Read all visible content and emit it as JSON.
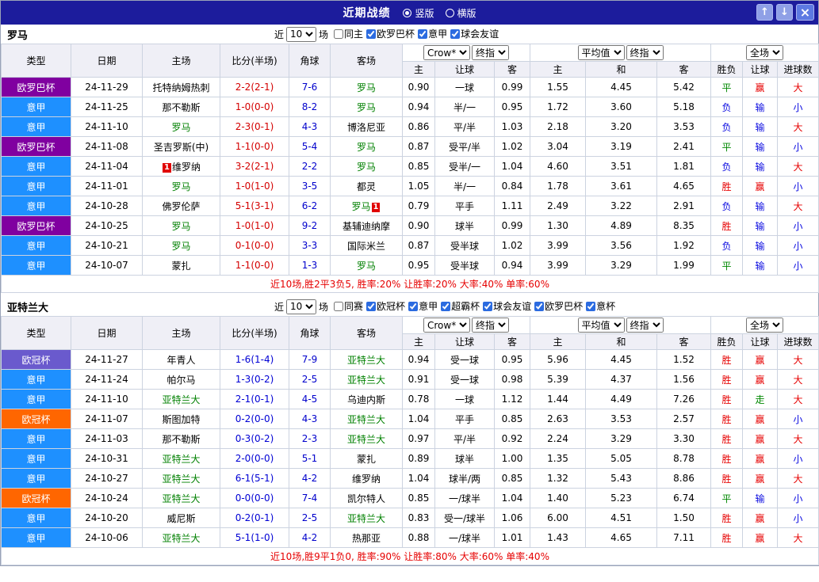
{
  "colors": {
    "css": {
      "titlebar-bg": "#1c1c9c",
      "grid-border": "#ccd3e0",
      "header-bg": "#efeff6",
      "summary-red": "#e60000",
      "badge-red": "#e00000",
      "btn-updown-bg": "#8fa0e6",
      "btn-close-bg": "#5d7ae2"
    },
    "team_self": "#008000",
    "result_map": {
      "胜": "#e60000",
      "赢": "#e60000",
      "大": "#e60000",
      "负": "#0b0be0",
      "输": "#0b0be0",
      "小": "#0b0be0",
      "平": "#008800",
      "走": "#008800"
    }
  },
  "titlebar": {
    "title": "近期战绩",
    "radios": [
      {
        "label": "竖版",
        "selected": true
      },
      {
        "label": "横版",
        "selected": false
      }
    ],
    "buttons": [
      {
        "name": "scroll-up",
        "glyph": "↑"
      },
      {
        "name": "scroll-down",
        "glyph": "↓"
      },
      {
        "name": "close",
        "glyph": "×"
      }
    ]
  },
  "columns": {
    "main": [
      "类型",
      "日期",
      "主场",
      "比分(半场)",
      "角球",
      "客场"
    ],
    "sub": [
      "主",
      "让球",
      "客",
      "主",
      "和",
      "客",
      "胜负",
      "让球",
      "进球数"
    ],
    "selects": [
      [
        "Crow*",
        "终指"
      ],
      [
        "平均值",
        "终指"
      ],
      [
        "全场"
      ]
    ]
  },
  "sections": [
    {
      "team": "罗马",
      "filter": {
        "prefix": "近",
        "count": "10",
        "suffix": "场",
        "checks": [
          {
            "label": "同主",
            "checked": false
          },
          {
            "label": "欧罗巴杯",
            "checked": true
          },
          {
            "label": "意甲",
            "checked": true
          },
          {
            "label": "球会友谊",
            "checked": true
          }
        ]
      },
      "score_color": "#d40000",
      "corner_color": "#0000cc",
      "rows": [
        {
          "type": "欧罗巴杯",
          "type_color": "#8000a0",
          "date": "24-11-29",
          "home": {
            "name": "托特纳姆热刺"
          },
          "score": "2-2(2-1)",
          "corner": "7-6",
          "away": {
            "name": "罗马",
            "self": true
          },
          "ah": [
            "0.90",
            "一球",
            "0.99"
          ],
          "eu": [
            "1.55",
            "4.45",
            "5.42"
          ],
          "res": [
            "平",
            "赢",
            "大"
          ]
        },
        {
          "type": "意甲",
          "type_color": "#1e90ff",
          "date": "24-11-25",
          "home": {
            "name": "那不勒斯"
          },
          "score": "1-0(0-0)",
          "corner": "8-2",
          "away": {
            "name": "罗马",
            "self": true
          },
          "ah": [
            "0.94",
            "半/一",
            "0.95"
          ],
          "eu": [
            "1.72",
            "3.60",
            "5.18"
          ],
          "res": [
            "负",
            "输",
            "小"
          ]
        },
        {
          "type": "意甲",
          "type_color": "#1e90ff",
          "date": "24-11-10",
          "home": {
            "name": "罗马",
            "self": true
          },
          "score": "2-3(0-1)",
          "corner": "4-3",
          "away": {
            "name": "博洛尼亚"
          },
          "ah": [
            "0.86",
            "平/半",
            "1.03"
          ],
          "eu": [
            "2.18",
            "3.20",
            "3.53"
          ],
          "res": [
            "负",
            "输",
            "大"
          ]
        },
        {
          "type": "欧罗巴杯",
          "type_color": "#8000a0",
          "date": "24-11-08",
          "home": {
            "name": "圣吉罗斯(中)"
          },
          "score": "1-1(0-0)",
          "corner": "5-4",
          "away": {
            "name": "罗马",
            "self": true
          },
          "ah": [
            "0.87",
            "受平/半",
            "1.02"
          ],
          "eu": [
            "3.04",
            "3.19",
            "2.41"
          ],
          "res": [
            "平",
            "输",
            "小"
          ]
        },
        {
          "type": "意甲",
          "type_color": "#1e90ff",
          "date": "24-11-04",
          "home": {
            "name": "维罗纳",
            "badge": "1",
            "badge_pos": "before"
          },
          "score": "3-2(2-1)",
          "corner": "2-2",
          "away": {
            "name": "罗马",
            "self": true
          },
          "ah": [
            "0.85",
            "受半/一",
            "1.04"
          ],
          "eu": [
            "4.60",
            "3.51",
            "1.81"
          ],
          "res": [
            "负",
            "输",
            "大"
          ]
        },
        {
          "type": "意甲",
          "type_color": "#1e90ff",
          "date": "24-11-01",
          "home": {
            "name": "罗马",
            "self": true
          },
          "score": "1-0(1-0)",
          "corner": "3-5",
          "away": {
            "name": "都灵"
          },
          "ah": [
            "1.05",
            "半/一",
            "0.84"
          ],
          "eu": [
            "1.78",
            "3.61",
            "4.65"
          ],
          "res": [
            "胜",
            "赢",
            "小"
          ]
        },
        {
          "type": "意甲",
          "type_color": "#1e90ff",
          "date": "24-10-28",
          "home": {
            "name": "佛罗伦萨"
          },
          "score": "5-1(3-1)",
          "corner": "6-2",
          "away": {
            "name": "罗马",
            "self": true,
            "badge": "1",
            "badge_pos": "after"
          },
          "ah": [
            "0.79",
            "平手",
            "1.11"
          ],
          "eu": [
            "2.49",
            "3.22",
            "2.91"
          ],
          "res": [
            "负",
            "输",
            "大"
          ]
        },
        {
          "type": "欧罗巴杯",
          "type_color": "#8000a0",
          "date": "24-10-25",
          "home": {
            "name": "罗马",
            "self": true
          },
          "score": "1-0(1-0)",
          "corner": "9-2",
          "away": {
            "name": "基辅迪纳摩"
          },
          "ah": [
            "0.90",
            "球半",
            "0.99"
          ],
          "eu": [
            "1.30",
            "4.89",
            "8.35"
          ],
          "res": [
            "胜",
            "输",
            "小"
          ]
        },
        {
          "type": "意甲",
          "type_color": "#1e90ff",
          "date": "24-10-21",
          "home": {
            "name": "罗马",
            "self": true
          },
          "score": "0-1(0-0)",
          "corner": "3-3",
          "away": {
            "name": "国际米兰"
          },
          "ah": [
            "0.87",
            "受半球",
            "1.02"
          ],
          "eu": [
            "3.99",
            "3.56",
            "1.92"
          ],
          "res": [
            "负",
            "输",
            "小"
          ]
        },
        {
          "type": "意甲",
          "type_color": "#1e90ff",
          "date": "24-10-07",
          "home": {
            "name": "蒙扎"
          },
          "score": "1-1(0-0)",
          "corner": "1-3",
          "away": {
            "name": "罗马",
            "self": true
          },
          "ah": [
            "0.95",
            "受半球",
            "0.94"
          ],
          "eu": [
            "3.99",
            "3.29",
            "1.99"
          ],
          "res": [
            "平",
            "输",
            "小"
          ]
        }
      ],
      "summary": "近10场,胜2平3负5, 胜率:20% 让胜率:20% 大率:40% 单率:60%"
    },
    {
      "team": "亚特兰大",
      "filter": {
        "prefix": "近",
        "count": "10",
        "suffix": "场",
        "checks": [
          {
            "label": "同赛",
            "checked": false
          },
          {
            "label": "欧冠杯",
            "checked": true
          },
          {
            "label": "意甲",
            "checked": true
          },
          {
            "label": "超霸杯",
            "checked": true
          },
          {
            "label": "球会友谊",
            "checked": true
          },
          {
            "label": "欧罗巴杯",
            "checked": true
          },
          {
            "label": "意杯",
            "checked": true
          }
        ]
      },
      "score_color": "#0000d4",
      "corner_color": "#0000cc",
      "rows": [
        {
          "type": "欧冠杯",
          "type_color": "#6a5acd",
          "date": "24-11-27",
          "home": {
            "name": "年青人"
          },
          "score": "1-6(1-4)",
          "corner": "7-9",
          "away": {
            "name": "亚特兰大",
            "self": true
          },
          "ah": [
            "0.94",
            "受一球",
            "0.95"
          ],
          "eu": [
            "5.96",
            "4.45",
            "1.52"
          ],
          "res": [
            "胜",
            "赢",
            "大"
          ]
        },
        {
          "type": "意甲",
          "type_color": "#1e90ff",
          "date": "24-11-24",
          "home": {
            "name": "帕尔马"
          },
          "score": "1-3(0-2)",
          "corner": "2-5",
          "away": {
            "name": "亚特兰大",
            "self": true
          },
          "ah": [
            "0.91",
            "受一球",
            "0.98"
          ],
          "eu": [
            "5.39",
            "4.37",
            "1.56"
          ],
          "res": [
            "胜",
            "赢",
            "大"
          ]
        },
        {
          "type": "意甲",
          "type_color": "#1e90ff",
          "date": "24-11-10",
          "home": {
            "name": "亚特兰大",
            "self": true
          },
          "score": "2-1(0-1)",
          "corner": "4-5",
          "away": {
            "name": "乌迪内斯"
          },
          "ah": [
            "0.78",
            "一球",
            "1.12"
          ],
          "eu": [
            "1.44",
            "4.49",
            "7.26"
          ],
          "res": [
            "胜",
            "走",
            "大"
          ]
        },
        {
          "type": "欧冠杯",
          "type_color": "#ff6600",
          "date": "24-11-07",
          "home": {
            "name": "斯图加特"
          },
          "score": "0-2(0-0)",
          "corner": "4-3",
          "away": {
            "name": "亚特兰大",
            "self": true
          },
          "ah": [
            "1.04",
            "平手",
            "0.85"
          ],
          "eu": [
            "2.63",
            "3.53",
            "2.57"
          ],
          "res": [
            "胜",
            "赢",
            "小"
          ]
        },
        {
          "type": "意甲",
          "type_color": "#1e90ff",
          "date": "24-11-03",
          "home": {
            "name": "那不勒斯"
          },
          "score": "0-3(0-2)",
          "corner": "2-3",
          "away": {
            "name": "亚特兰大",
            "self": true
          },
          "ah": [
            "0.97",
            "平/半",
            "0.92"
          ],
          "eu": [
            "2.24",
            "3.29",
            "3.30"
          ],
          "res": [
            "胜",
            "赢",
            "大"
          ]
        },
        {
          "type": "意甲",
          "type_color": "#1e90ff",
          "date": "24-10-31",
          "home": {
            "name": "亚特兰大",
            "self": true
          },
          "score": "2-0(0-0)",
          "corner": "5-1",
          "away": {
            "name": "蒙扎"
          },
          "ah": [
            "0.89",
            "球半",
            "1.00"
          ],
          "eu": [
            "1.35",
            "5.05",
            "8.78"
          ],
          "res": [
            "胜",
            "赢",
            "小"
          ]
        },
        {
          "type": "意甲",
          "type_color": "#1e90ff",
          "date": "24-10-27",
          "home": {
            "name": "亚特兰大",
            "self": true
          },
          "score": "6-1(5-1)",
          "corner": "4-2",
          "away": {
            "name": "维罗纳"
          },
          "ah": [
            "1.04",
            "球半/两",
            "0.85"
          ],
          "eu": [
            "1.32",
            "5.43",
            "8.86"
          ],
          "res": [
            "胜",
            "赢",
            "大"
          ]
        },
        {
          "type": "欧冠杯",
          "type_color": "#ff6600",
          "date": "24-10-24",
          "home": {
            "name": "亚特兰大",
            "self": true
          },
          "score": "0-0(0-0)",
          "corner": "7-4",
          "away": {
            "name": "凯尔特人"
          },
          "ah": [
            "0.85",
            "一/球半",
            "1.04"
          ],
          "eu": [
            "1.40",
            "5.23",
            "6.74"
          ],
          "res": [
            "平",
            "输",
            "小"
          ]
        },
        {
          "type": "意甲",
          "type_color": "#1e90ff",
          "date": "24-10-20",
          "home": {
            "name": "威尼斯"
          },
          "score": "0-2(0-1)",
          "corner": "2-5",
          "away": {
            "name": "亚特兰大",
            "self": true
          },
          "ah": [
            "0.83",
            "受一/球半",
            "1.06"
          ],
          "eu": [
            "6.00",
            "4.51",
            "1.50"
          ],
          "res": [
            "胜",
            "赢",
            "小"
          ]
        },
        {
          "type": "意甲",
          "type_color": "#1e90ff",
          "date": "24-10-06",
          "home": {
            "name": "亚特兰大",
            "self": true
          },
          "score": "5-1(1-0)",
          "corner": "4-2",
          "away": {
            "name": "热那亚"
          },
          "ah": [
            "0.88",
            "一/球半",
            "1.01"
          ],
          "eu": [
            "1.43",
            "4.65",
            "7.11"
          ],
          "res": [
            "胜",
            "赢",
            "大"
          ]
        }
      ],
      "summary": "近10场,胜9平1负0, 胜率:90% 让胜率:80% 大率:60% 单率:40%"
    }
  ]
}
